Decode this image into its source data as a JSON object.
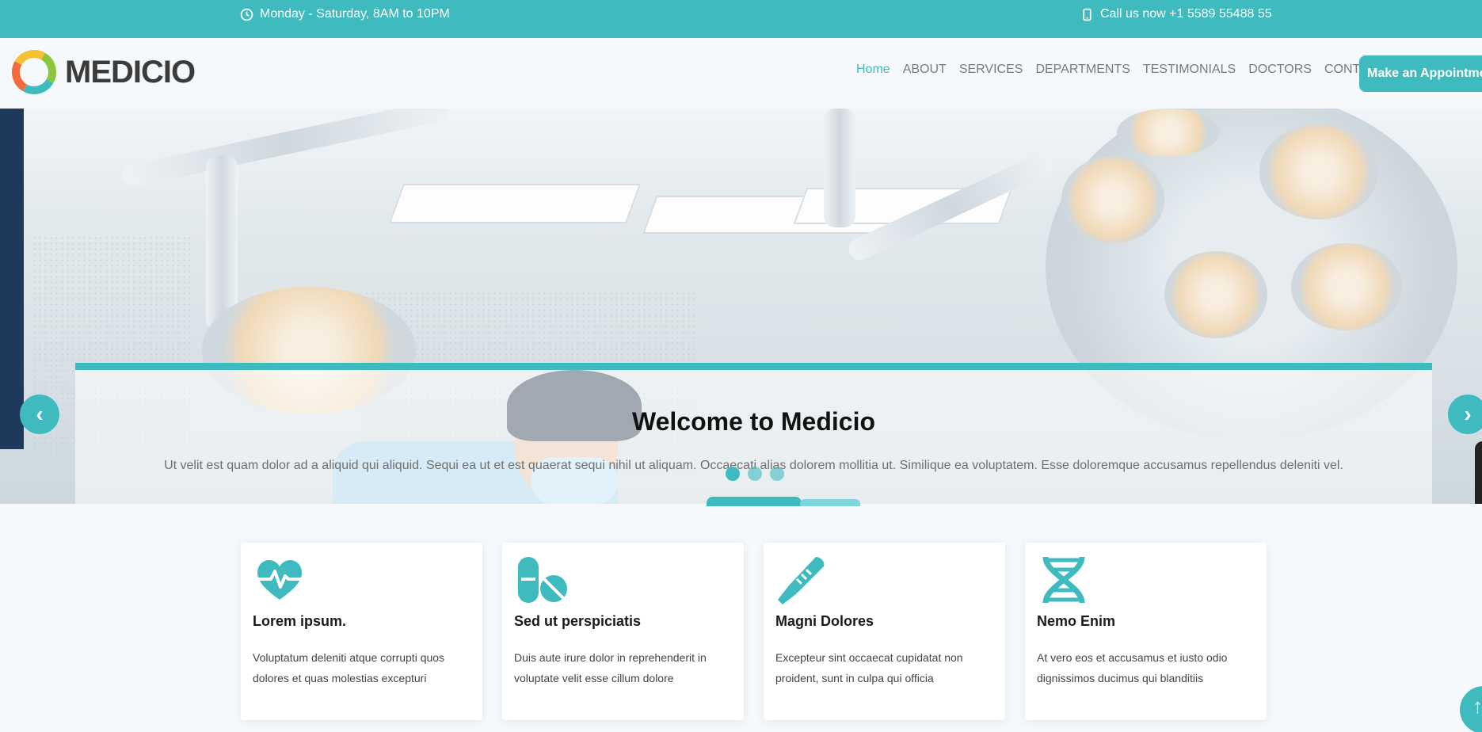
{
  "topbar": {
    "hours": "Monday - Saturday, 8AM to 10PM",
    "phone": "Call us now +1 5589 55488 55",
    "hours_icon": "clock-icon",
    "phone_icon": "phone-icon"
  },
  "header": {
    "logo_text": "MEDICIO",
    "nav": {
      "home": "Home",
      "about": "ABOUT",
      "services": "SERVICES",
      "departments": "DEPARTMENTS",
      "testimonials": "TESTIMONIALS",
      "doctors": "DOCTORS",
      "contact": "CONTACT"
    },
    "appointment_button": "Make an Appointment"
  },
  "hero": {
    "title": "Welcome to Medicio",
    "text": "Ut velit est quam dolor ad a aliquid qui aliquid. Sequi ea ut et est quaerat sequi nihil ut aliquam. Occaecati alias dolorem mollitia ut. Similique ea voluptatem. Esse doloremque accusamus repellendus deleniti vel.",
    "prev_icon": "chevron-left-icon",
    "next_icon": "chevron-right-icon",
    "prev_glyph": "‹",
    "next_glyph": "›",
    "slide_count": 3,
    "active_slide": 1
  },
  "features": [
    {
      "icon": "heart-pulse-icon",
      "title": "Lorem ipsum.",
      "text": "Voluptatum deleniti atque corrupti quos dolores et quas molestias excepturi"
    },
    {
      "icon": "pills-icon",
      "title": "Sed ut perspiciatis",
      "text": "Duis aute irure dolor in reprehenderit in voluptate velit esse cillum dolore"
    },
    {
      "icon": "thermometer-icon",
      "title": "Magni Dolores",
      "text": "Excepteur sint occaecat cupidatat non proident, sunt in culpa qui officia"
    },
    {
      "icon": "dna-icon",
      "title": "Nemo Enim",
      "text": "At vero eos et accusamus et iusto odio dignissimos ducimus qui blanditiis"
    }
  ],
  "back_to_top_glyph": "↑",
  "colors": {
    "accent": "#3fbbc0",
    "text_dark": "#1a1a1a"
  }
}
